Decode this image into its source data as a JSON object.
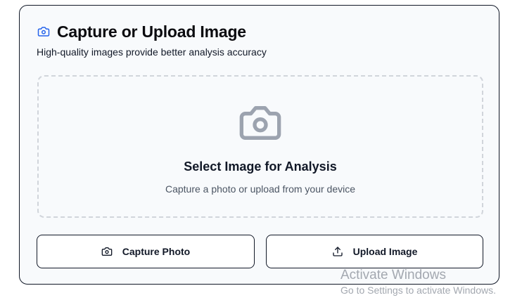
{
  "card": {
    "title": "Capture or Upload Image",
    "subtitle": "High-quality images provide better analysis accuracy"
  },
  "dropzone": {
    "title": "Select Image for Analysis",
    "subtitle": "Capture a photo or upload from your device"
  },
  "buttons": {
    "capture_label": "Capture Photo",
    "upload_label": "Upload Image"
  },
  "watermark": {
    "line1": "Activate Windows",
    "line2": "Go to Settings to activate Windows."
  },
  "icons": {
    "header": "camera-icon",
    "dropzone": "camera-icon",
    "capture": "camera-icon",
    "upload": "upload-icon"
  },
  "colors": {
    "accent": "#2563eb",
    "border": "#111827",
    "dashed_border": "#d1d5db",
    "dropzone_icon": "#9ca3af"
  }
}
